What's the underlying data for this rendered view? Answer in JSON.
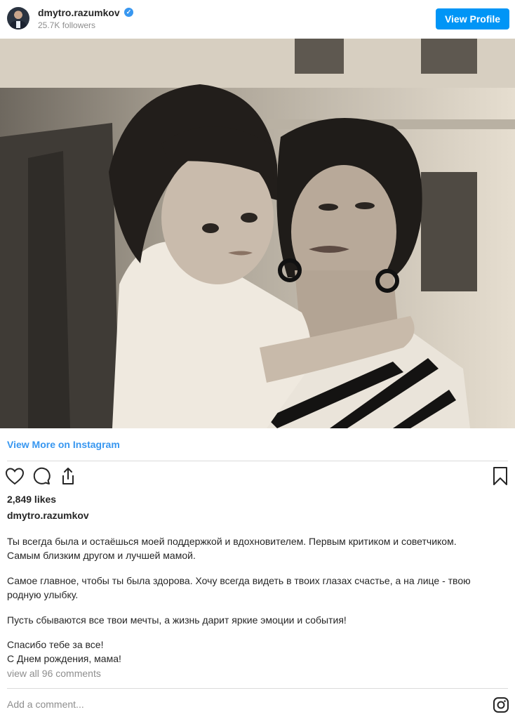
{
  "header": {
    "username": "dmytro.razumkov",
    "followers": "25.7K followers",
    "view_profile": "View Profile"
  },
  "post": {
    "view_more": "View More on Instagram",
    "likes": "2,849 likes",
    "owner": "dmytro.razumkov",
    "caption": [
      "Ты всегда была и остаёшься моей поддержкой и вдохновителем. Первым критиком и советчиком.",
      "Самым близким другом и лучшей мамой.",
      "Самое главное, чтобы ты была здорова. Хочу всегда видеть в твоих глазах счастье, а на лице - твою",
      "родную улыбку.",
      "Пусть сбываются все твои мечты, а жизнь дарит яркие эмоции и события!",
      "Спасибо тебе за все!",
      "С Днем рождения, мама!"
    ],
    "view_comments": "view all 96 comments",
    "add_comment_placeholder": "Add a comment..."
  },
  "colors": {
    "accent": "#0095f6",
    "link": "#3897f0",
    "muted": "#8e8e8e",
    "text": "#262626"
  },
  "icons": [
    "verified-badge-icon",
    "heart-icon",
    "comment-icon",
    "share-icon",
    "bookmark-icon",
    "instagram-icon"
  ]
}
